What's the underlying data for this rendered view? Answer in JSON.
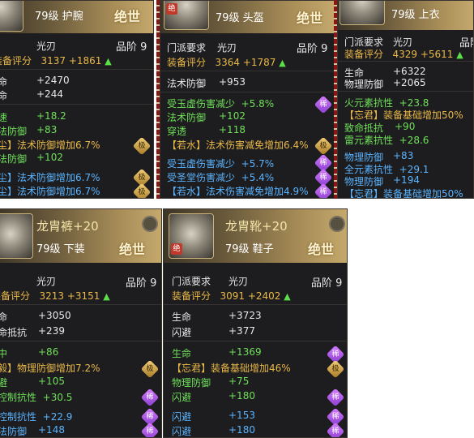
{
  "labels": {
    "sect_req": "门派要求",
    "gear_score": "装备评分",
    "grade_label": "品阶",
    "tier": "绝世",
    "up_arrow": "▲",
    "gem_rare": "稀",
    "gem_epic": "极",
    "gear_badge": "绝"
  },
  "colors": {
    "card_bg": "#1d1c1e",
    "header_gold": "#c4a86c",
    "stat_white": "#e9e9e9",
    "stat_green": "#6fe05a",
    "stat_blue": "#5ab4ff",
    "score_gold": "#e9b949",
    "gem_purple": "#b25ce8",
    "gem_gold": "#d2a84a"
  },
  "cards": [
    {
      "title": "",
      "level_type": "79级 护腕",
      "sect": "光刃",
      "grade": "9",
      "score": "3137",
      "score_bonus": "+1861",
      "base_stats": [
        {
          "label": "命",
          "value": "+2470"
        },
        {
          "label": "命",
          "value": "+244"
        }
      ],
      "extra_stats": [
        {
          "label": "速",
          "value": "+18.2"
        },
        {
          "label": "法防御",
          "value": "+83"
        },
        {
          "label": "尘】",
          "value": "法术防御增加6.7%"
        },
        {
          "label": "法防御",
          "value": "+102"
        },
        {
          "label": "尘】",
          "value": "法术防御增加6.7%"
        },
        {
          "label": "尘】",
          "value": "法术防御增加6.7%"
        }
      ]
    },
    {
      "title": "",
      "level_type": "79级 头盔",
      "sect": "光刃",
      "grade": "9",
      "score": "3364",
      "score_bonus": "+1787",
      "base_stats": [
        {
          "label": "法术防御",
          "value": "+953"
        }
      ],
      "extra_stats": [
        {
          "label": "受玉虚伤害减少",
          "value": "+5.8%"
        },
        {
          "label": "法术防御",
          "value": "+102"
        },
        {
          "label": "穿透",
          "value": "+118"
        },
        {
          "label": "【若水】",
          "value": "法术伤害减免增加6.4%"
        },
        {
          "label": "受玉虚伤害减少",
          "value": "+5.7%"
        },
        {
          "label": "受圣堂伤害减少",
          "value": "+5.4%"
        },
        {
          "label": "【若水】",
          "value": "法术伤害减免增加4.9%"
        }
      ]
    },
    {
      "title": "",
      "level_type": "79级 上衣",
      "sect": "光刃",
      "grade": "",
      "score": "4329",
      "score_bonus": "+5611",
      "base_stats": [
        {
          "label": "生命",
          "value": "+6322"
        },
        {
          "label": "物理防御",
          "value": "+2065"
        }
      ],
      "extra_stats": [
        {
          "label": "火元素抗性",
          "value": "+23.8"
        },
        {
          "label": "【忘君】",
          "value": "装备基础增加50%"
        },
        {
          "label": "致命抵抗",
          "value": "+90"
        },
        {
          "label": "雷元素抗性",
          "value": "+28.6"
        },
        {
          "label": "物理防御",
          "value": "+83"
        },
        {
          "label": "全元素抗性",
          "value": "+29.1"
        },
        {
          "label": "物理防御",
          "value": "+194"
        },
        {
          "label": "【忘君】",
          "value": "装备基础增加50%"
        }
      ]
    },
    {
      "title": "龙胄裤+20",
      "level_type": "79级 下装",
      "sect": "光刃",
      "grade": "9",
      "score": "3213",
      "score_bonus": "+3151",
      "base_stats": [
        {
          "label": "命",
          "value": "+3050"
        },
        {
          "label": "命抵抗",
          "value": "+239"
        }
      ],
      "extra_stats": [
        {
          "label": "中",
          "value": "+86"
        },
        {
          "label": "毅】",
          "value": "物理防御增加7.2%"
        },
        {
          "label": "避",
          "value": "+105"
        },
        {
          "label": "控制抗性",
          "value": "+30.5"
        },
        {
          "label": "控制抗性",
          "value": "+22.9"
        },
        {
          "label": "法防御",
          "value": "+148"
        }
      ]
    },
    {
      "title": "龙胄靴+20",
      "level_type": "79级 鞋子",
      "sect": "光刃",
      "grade": "9",
      "score": "3091",
      "score_bonus": "+2402",
      "base_stats": [
        {
          "label": "生命",
          "value": "+3723"
        },
        {
          "label": "闪避",
          "value": "+377"
        }
      ],
      "extra_stats": [
        {
          "label": "生命",
          "value": "+1369"
        },
        {
          "label": "【忘君】",
          "value": "装备基础增加46%"
        },
        {
          "label": "物理防御",
          "value": "+75"
        },
        {
          "label": "闪避",
          "value": "+180"
        },
        {
          "label": "闪避",
          "value": "+153"
        },
        {
          "label": "闪避",
          "value": "+180"
        }
      ]
    }
  ]
}
